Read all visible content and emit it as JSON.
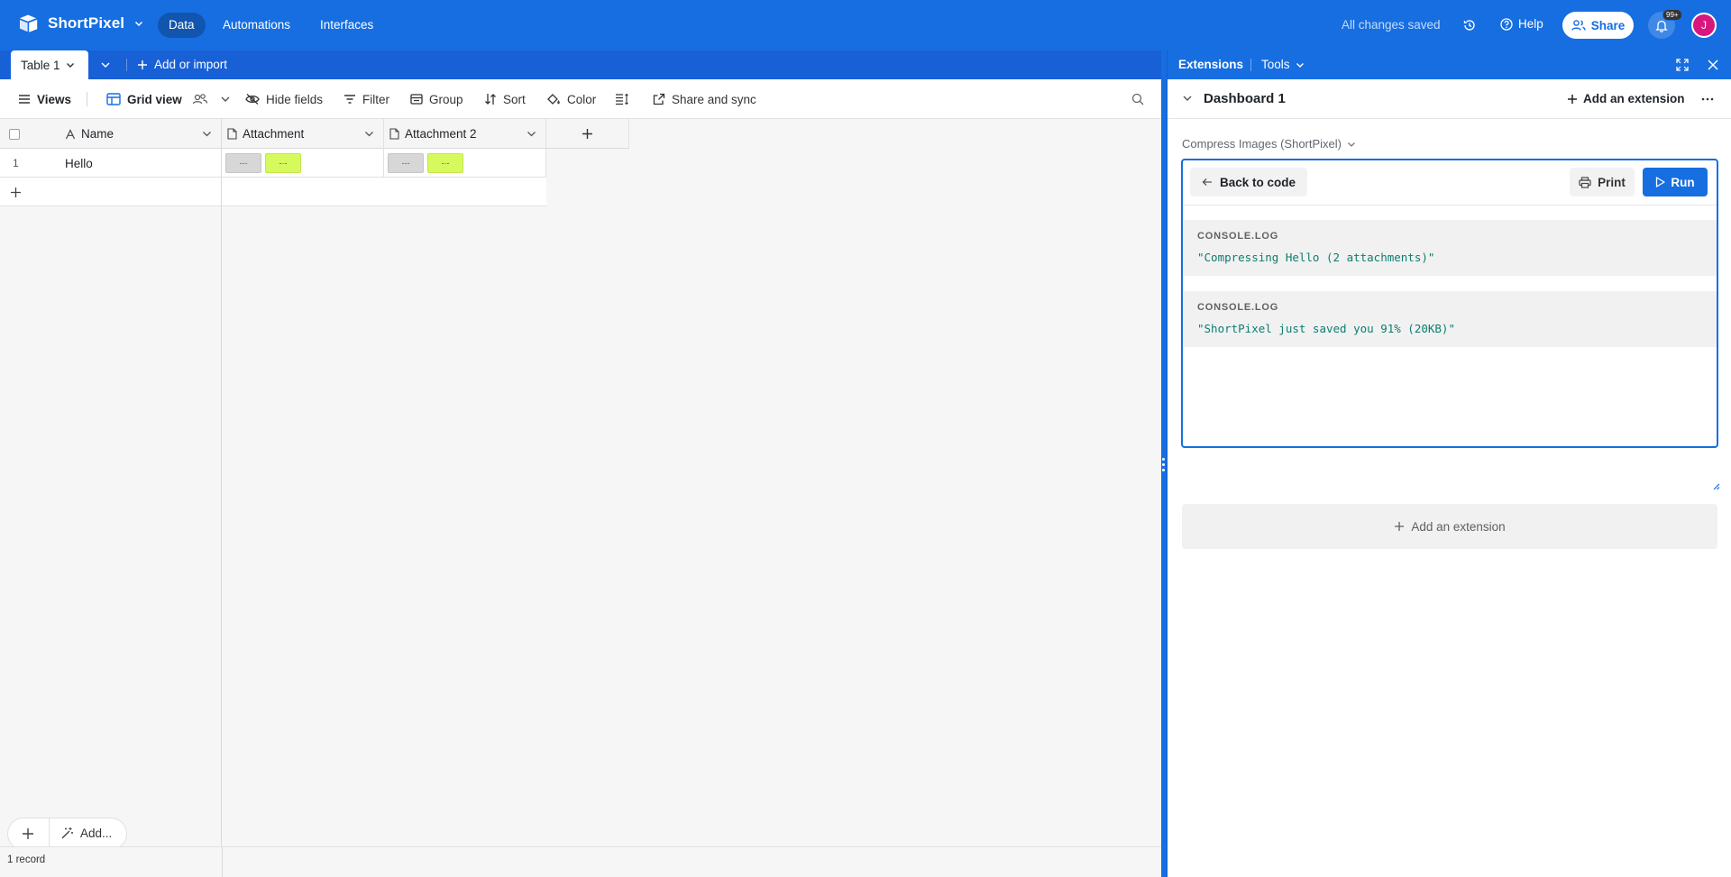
{
  "header": {
    "app_name": "ShortPixel",
    "nav": [
      {
        "label": "Data",
        "active": true
      },
      {
        "label": "Automations",
        "active": false
      },
      {
        "label": "Interfaces",
        "active": false
      }
    ],
    "save_status": "All changes saved",
    "help_label": "Help",
    "share_label": "Share",
    "notification_badge": "99+",
    "avatar_initial": "J",
    "colors": {
      "brand": "#166ee1",
      "avatar": "#d7177d"
    }
  },
  "tabs": {
    "active_table": "Table 1",
    "add_or_import": "Add or import"
  },
  "toolbar": {
    "views_label": "Views",
    "view_name": "Grid view",
    "hide_fields": "Hide fields",
    "filter": "Filter",
    "group": "Group",
    "sort": "Sort",
    "color": "Color",
    "share_and_sync": "Share and sync"
  },
  "grid": {
    "columns": [
      {
        "name": "Name",
        "icon": "text-field-icon"
      },
      {
        "name": "Attachment",
        "icon": "attachment-file-icon"
      },
      {
        "name": "Attachment 2",
        "icon": "attachment-file-icon"
      }
    ],
    "rows": [
      {
        "number": "1",
        "name": "Hello",
        "attachment": [
          "---",
          "-·-"
        ],
        "attachment_2": [
          "---",
          "-·-"
        ]
      }
    ],
    "add_label": "Add...",
    "record_count": "1 record"
  },
  "extensions": {
    "title": "Extensions",
    "tools_label": "Tools",
    "dashboard_title": "Dashboard 1",
    "add_extension_top": "Add an extension",
    "extension_name": "Compress Images (ShortPixel)",
    "back_label": "Back to code",
    "print_label": "Print",
    "run_label": "Run",
    "logs": [
      {
        "type": "CONSOLE.LOG",
        "value": "\"Compressing Hello (2 attachments)\""
      },
      {
        "type": "CONSOLE.LOG",
        "value": "\"ShortPixel just saved you 91% (20KB)\""
      }
    ],
    "add_extension_bottom": "Add an extension"
  }
}
